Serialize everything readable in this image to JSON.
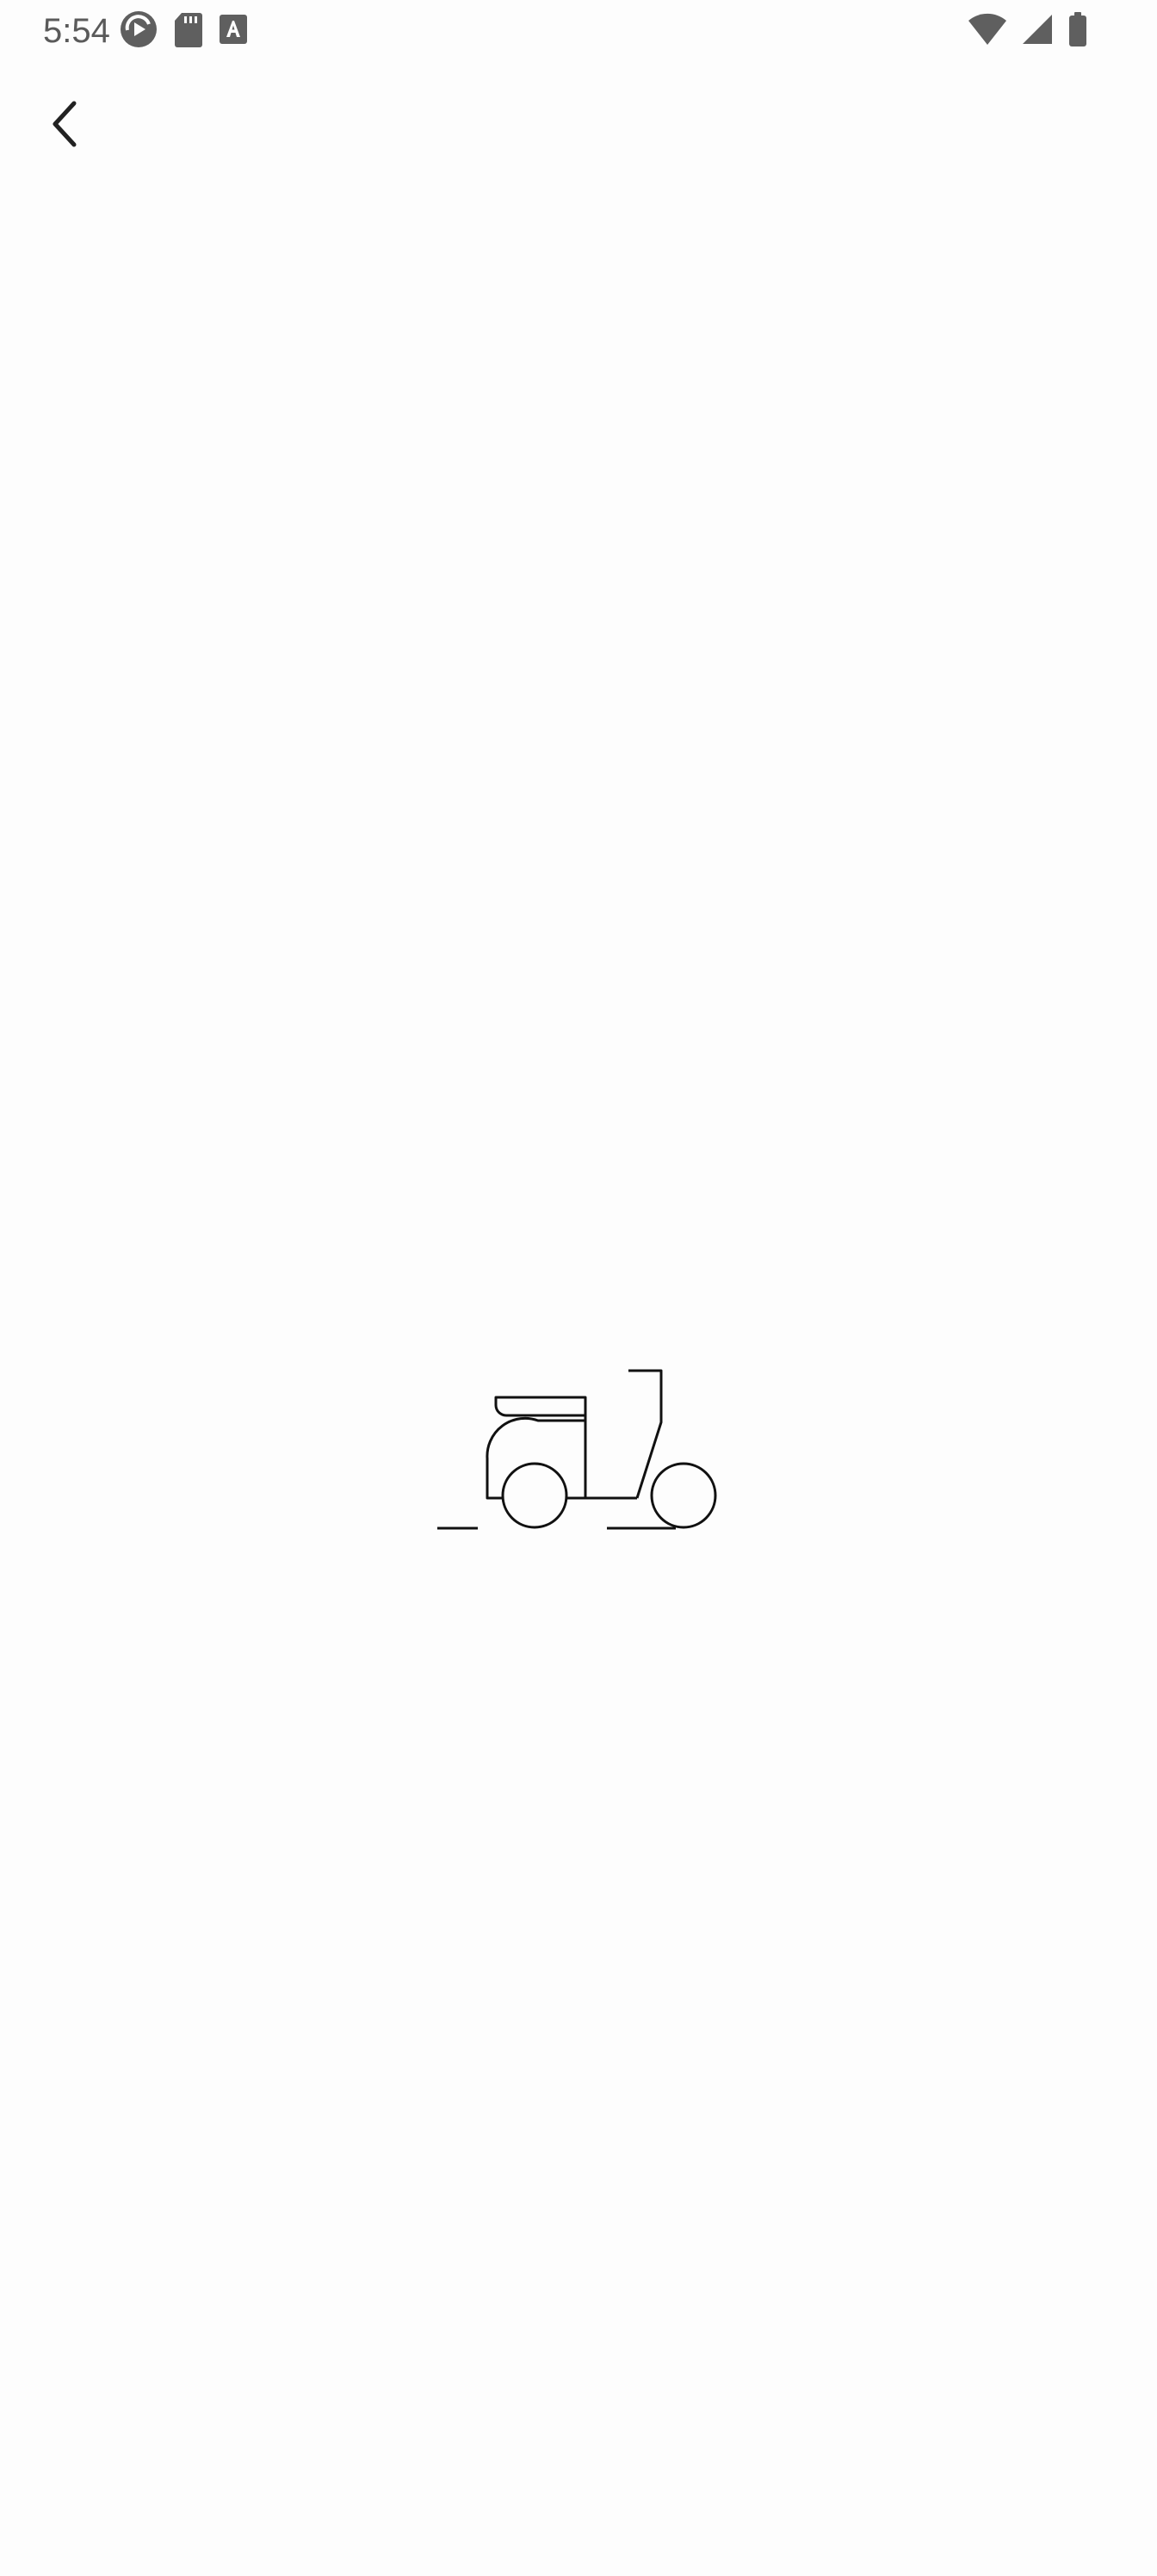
{
  "status_bar": {
    "time": "5:54",
    "left_icons": [
      "sync-play-icon",
      "sd-card-icon",
      "text-a-icon"
    ],
    "right_icons": [
      "wifi-icon",
      "cell-signal-icon",
      "battery-icon"
    ]
  },
  "app_bar": {
    "back_icon": "chevron-left-icon"
  },
  "content": {
    "illustration": "scooter-icon"
  },
  "colors": {
    "background": "#fdfdfd",
    "status_icon": "#5f5f5f",
    "line_art": "#111111"
  }
}
